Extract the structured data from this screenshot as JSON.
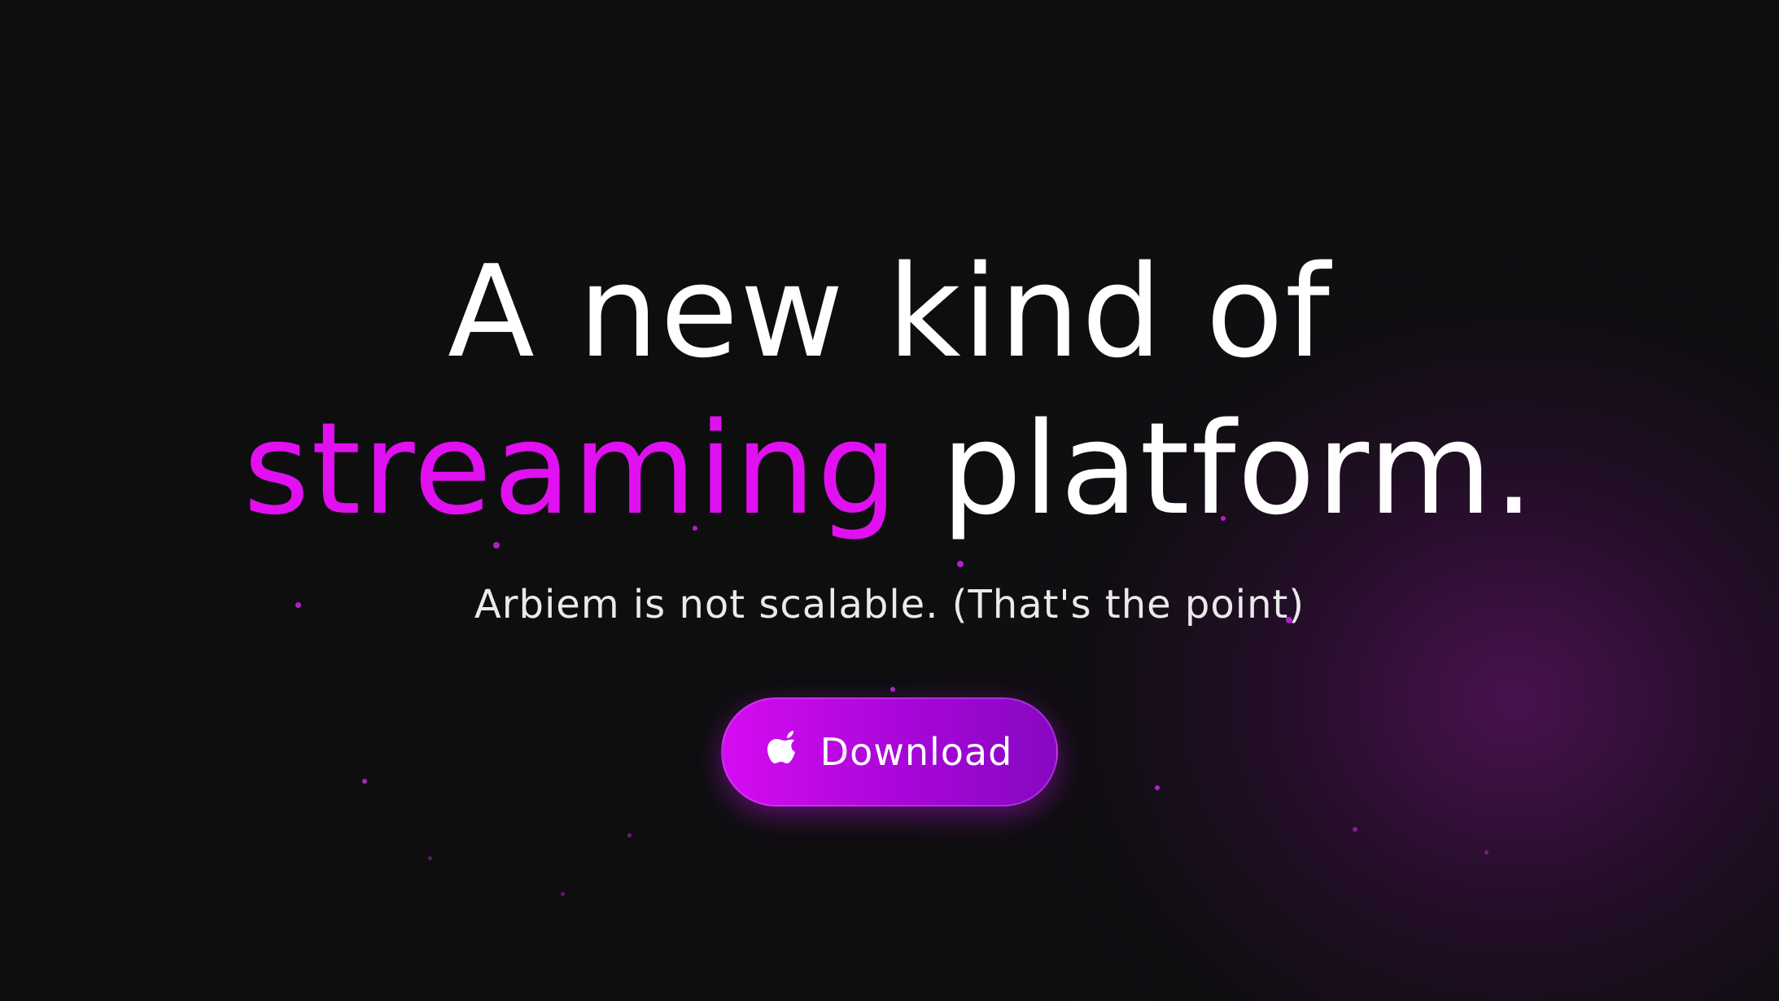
{
  "hero": {
    "line1": "A new kind of",
    "line2_accent": "streaming",
    "line2_rest": " platform.",
    "subtitle": "Arbiem is not scalable. (That's the point)"
  },
  "download": {
    "label": "Download",
    "icon": "apple-icon"
  },
  "colors": {
    "background": "#0e0e0f",
    "accent": "#e010f0",
    "button_start": "#d50cf0",
    "button_end": "#8608c2"
  }
}
